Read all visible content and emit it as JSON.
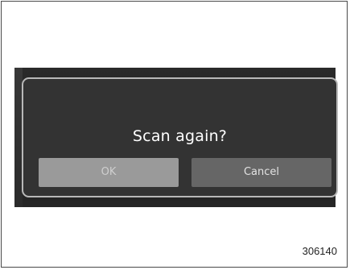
{
  "dialog": {
    "title": "Scan again?",
    "ok_label": "OK",
    "cancel_label": "Cancel"
  },
  "figure": {
    "number": "306140"
  },
  "colors": {
    "background": "#ffffff",
    "screen": "#222222",
    "dialog_bg": "#333333",
    "dialog_border": "#b8b8b8",
    "ok_button": "#9a9a9a",
    "cancel_button": "#666666"
  }
}
